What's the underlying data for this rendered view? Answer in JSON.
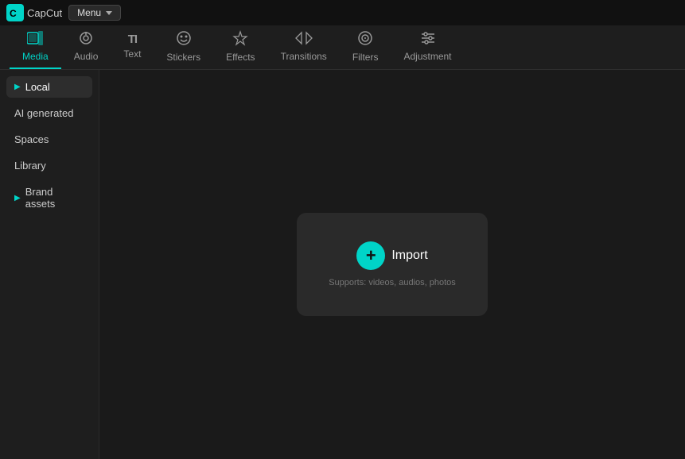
{
  "titlebar": {
    "logo_alt": "CapCut",
    "menu_label": "Menu"
  },
  "topnav": {
    "tabs": [
      {
        "id": "media",
        "label": "Media",
        "icon": "⬛",
        "active": true
      },
      {
        "id": "audio",
        "label": "Audio",
        "icon": "⏻"
      },
      {
        "id": "text",
        "label": "Text",
        "icon": "TI"
      },
      {
        "id": "stickers",
        "label": "Stickers",
        "icon": "☺"
      },
      {
        "id": "effects",
        "label": "Effects",
        "icon": "✦"
      },
      {
        "id": "transitions",
        "label": "Transitions",
        "icon": "▷◁"
      },
      {
        "id": "filters",
        "label": "Filters",
        "icon": "◎"
      },
      {
        "id": "adjustment",
        "label": "Adjustment",
        "icon": "⚌"
      }
    ]
  },
  "sidebar": {
    "items": [
      {
        "id": "local",
        "label": "Local",
        "arrow": true
      },
      {
        "id": "ai-generated",
        "label": "AI generated",
        "arrow": false
      },
      {
        "id": "spaces",
        "label": "Spaces",
        "arrow": false
      },
      {
        "id": "library",
        "label": "Library",
        "arrow": false
      },
      {
        "id": "brand-assets",
        "label": "Brand assets",
        "arrow": true
      }
    ]
  },
  "import_card": {
    "plus_icon": "+",
    "label": "Import",
    "sublabel": "Supports: videos, audios, photos"
  }
}
